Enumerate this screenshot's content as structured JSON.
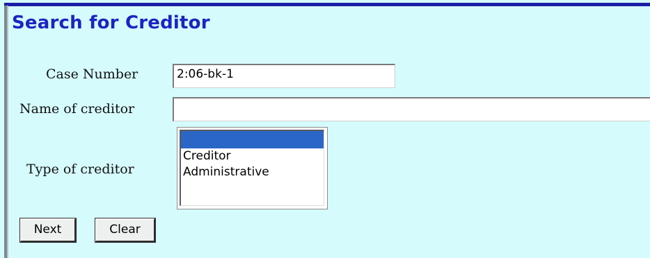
{
  "page": {
    "title": "Search for Creditor"
  },
  "form": {
    "case_number_label": "Case Number",
    "case_number_value": "2:06-bk-1",
    "name_label": "Name of creditor",
    "name_value": "",
    "type_label": "Type of creditor",
    "type_options": [
      "",
      "Creditor",
      "Administrative"
    ],
    "type_selected": ""
  },
  "buttons": {
    "next_label": "Next",
    "clear_label": "Clear"
  },
  "colors": {
    "background": "#d6fbfd",
    "title": "#1b24c2",
    "selection": "#2a66c6"
  }
}
